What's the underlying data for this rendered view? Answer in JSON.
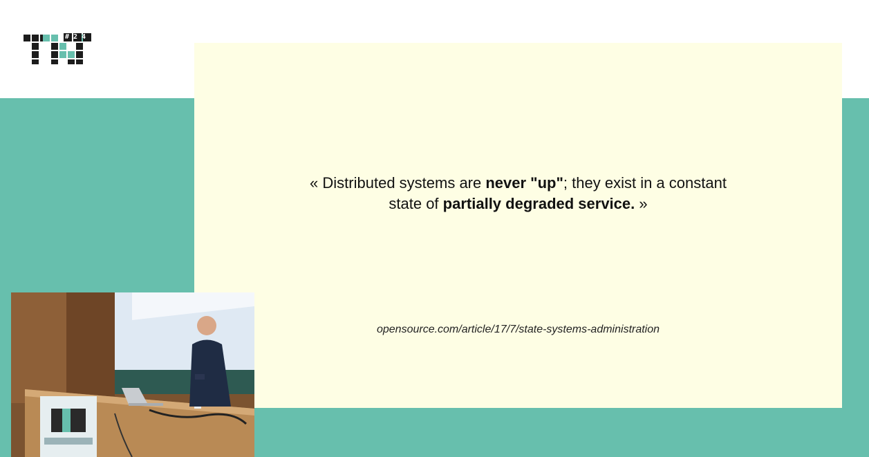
{
  "logo": {
    "letters": "TN",
    "edition": "#24"
  },
  "slide": {
    "quote": {
      "open": "« Distributed systems are ",
      "bold1": "never \"up\"",
      "mid": "; they exist in a constant",
      "line2_prefix": "state of ",
      "bold2": "partially degraded service.",
      "close": " »"
    },
    "source": "opensource.com/article/17/7/state-systems-administration"
  },
  "colors": {
    "teal": "#67bfad",
    "slide_background": "#fefee4",
    "logo_dark": "#1c1c1c"
  },
  "webcam": {
    "description_icon": "speaker-camera-feed"
  }
}
